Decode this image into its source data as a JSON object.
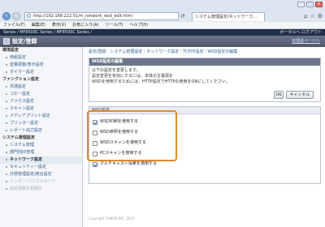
{
  "browser": {
    "url": "http://192.168.222.51/m_network_wsd_edit.html",
    "tab_label": "システム管理設定/ネットワーク…",
    "menu": [
      "ファイル(F)",
      "編集(E)",
      "表示(V)",
      "お気に入り(A)",
      "ツール(T)",
      "ヘルプ(H)"
    ]
  },
  "header": {
    "brand_left": "Series / MF8500C Series / MF8500C Series /",
    "brand_right": "ポータルへ  ログアウト",
    "title": "設定/登録",
    "portal_link": "管理者ページへ"
  },
  "sidebar": {
    "groups": [
      {
        "heading": "環境設定",
        "items": [
          "用紙設定",
          "音量調整/表示設定",
          "タイマー設定"
        ]
      },
      {
        "heading": "ファンクション設定",
        "items": [
          "共通設定",
          "コピー設定",
          "ファクス設定",
          "スキャン設定",
          "メディアプリント設定",
          "プリンター設定",
          "レポート出力設定"
        ]
      },
      {
        "heading": "システム管理設定",
        "items": [
          "システム管理",
          "部門別ID管理",
          "ネットワーク設定",
          "セキュリティー設定",
          "外部管理設定/統合設定",
          "インポート/エクスポート",
          "設定情報を初期化"
        ]
      }
    ],
    "active_item": "ネットワーク設定"
  },
  "main": {
    "breadcrumb": "設定/登録 : システム管理設定 : ネットワーク設定 : TCP/IP設定 : WSD設定の編集",
    "panel": {
      "title": "WSD設定の編集",
      "lines": [
        "以下の設定を変更します。",
        "設定変更を有効にするには、本体の主電源を",
        "WSDを使用するためには、HTTP設定でHTTPの使用をONにしてください。"
      ],
      "ok_label": "OK",
      "cancel_label": "キャンセル"
    },
    "settings": {
      "heading": "WSD設定",
      "options": [
        {
          "label": "WSD印刷を使用する",
          "checked": true
        },
        {
          "label": "WSD参照を使用する",
          "checked": false
        },
        {
          "label": "WSDスキャンを使用する",
          "checked": false
        },
        {
          "label": "PCスキャンを使用する",
          "checked": false
        },
        {
          "label": "マルチキャスト探索を使用する",
          "checked": true
        }
      ]
    },
    "footer": "Copyright CANON INC. 2013"
  }
}
